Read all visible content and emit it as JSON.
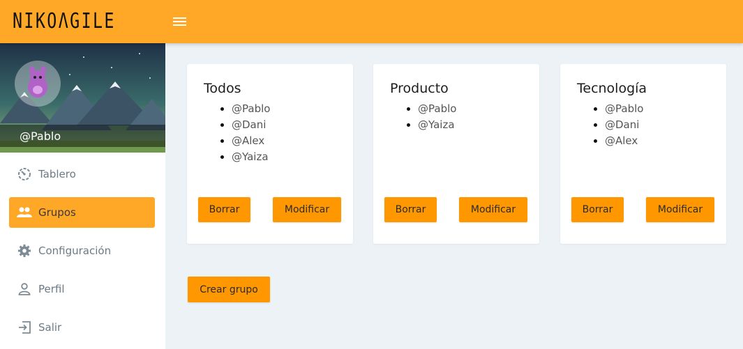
{
  "app": {
    "logo": "NIKOΛGILE"
  },
  "header": {
    "menu_icon": "hamburger-icon"
  },
  "sidebar": {
    "username": "@Pablo",
    "items": [
      {
        "label": "Tablero",
        "icon": "dashboard-icon",
        "active": false
      },
      {
        "label": "Grupos",
        "icon": "people-icon",
        "active": true
      },
      {
        "label": "Configuración",
        "icon": "gear-icon",
        "active": false
      },
      {
        "label": "Perfil",
        "icon": "person-icon",
        "active": false
      },
      {
        "label": "Salir",
        "icon": "logout-icon",
        "active": false
      }
    ]
  },
  "groups": [
    {
      "title": "Todos",
      "members": [
        "@Pablo",
        "@Dani",
        "@Alex",
        "@Yaiza"
      ],
      "delete_label": "Borrar",
      "edit_label": "Modificar"
    },
    {
      "title": "Producto",
      "members": [
        "@Pablo",
        "@Yaiza"
      ],
      "delete_label": "Borrar",
      "edit_label": "Modificar"
    },
    {
      "title": "Tecnología",
      "members": [
        "@Pablo",
        "@Dani",
        "@Alex"
      ],
      "delete_label": "Borrar",
      "edit_label": "Modificar"
    }
  ],
  "actions": {
    "create_label": "Crear grupo"
  },
  "colors": {
    "accent": "#ffa726",
    "button": "#ff9800",
    "background": "#edf2f6"
  }
}
